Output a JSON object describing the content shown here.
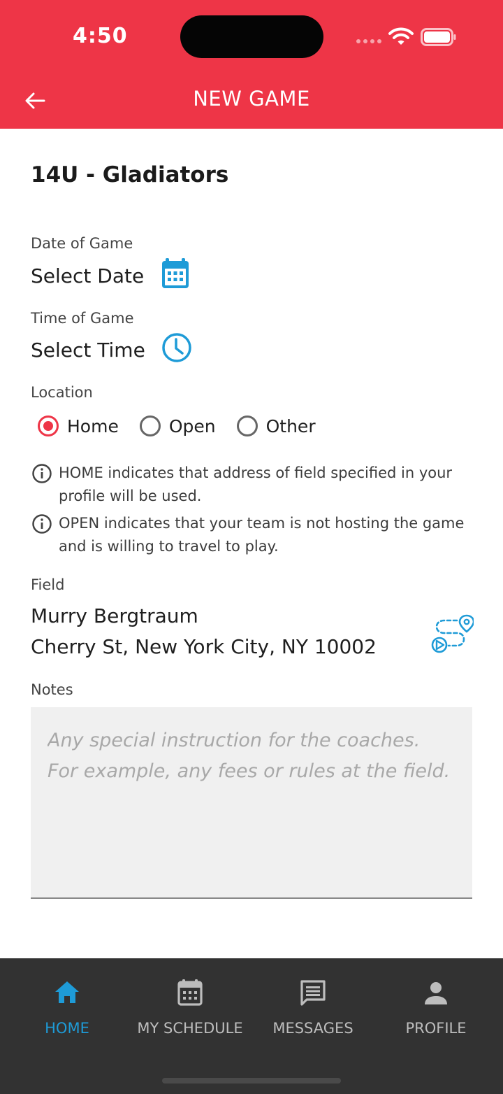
{
  "status": {
    "time": "4:50"
  },
  "header": {
    "title": "NEW GAME"
  },
  "team": {
    "name": "14U - Gladiators"
  },
  "date": {
    "label": "Date of Game",
    "value": "Select Date"
  },
  "time": {
    "label": "Time of Game",
    "value": "Select Time"
  },
  "location": {
    "label": "Location",
    "options": [
      "Home",
      "Open",
      "Other"
    ],
    "selected": "Home"
  },
  "info": {
    "home_note": "HOME indicates that address of field specified in your profile will be used.",
    "open_note": "OPEN indicates that your team is not hosting the game and is willing to travel to play."
  },
  "field": {
    "label": "Field",
    "name": "Murry Bergtraum",
    "address": "Cherry St, New York City, NY 10002"
  },
  "notes": {
    "label": "Notes",
    "value": "",
    "placeholder": "Any special instruction for the coaches. For example, any fees or rules at the field."
  },
  "tabs": [
    {
      "label": "HOME",
      "icon": "home-icon",
      "active": true
    },
    {
      "label": "MY SCHEDULE",
      "icon": "calendar-icon",
      "active": false
    },
    {
      "label": "MESSAGES",
      "icon": "message-icon",
      "active": false
    },
    {
      "label": "PROFILE",
      "icon": "person-icon",
      "active": false
    }
  ],
  "colors": {
    "accent": "#ee3547",
    "active_tab": "#1e9bd7",
    "icon_blue": "#1e9bd7",
    "tabbar_bg": "#323232"
  }
}
